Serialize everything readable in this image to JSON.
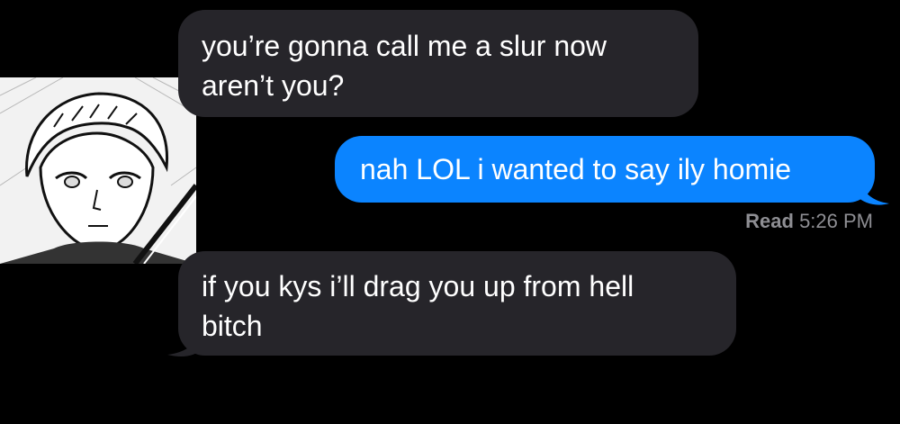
{
  "messages": [
    {
      "direction": "incoming",
      "lines": [
        "you’re gonna call me a slur now",
        "aren’t you?"
      ]
    },
    {
      "direction": "outgoing",
      "lines": [
        "nah LOL i wanted to say ily homie"
      ]
    },
    {
      "direction": "incoming",
      "lines": [
        "if you kys i’ll drag you up from hell",
        "bitch"
      ]
    }
  ],
  "read_receipt": {
    "label": "Read",
    "time": "5:26 PM"
  },
  "colors": {
    "background": "#000000",
    "incoming_bubble": "#26252a",
    "outgoing_bubble": "#0b84ff",
    "receipt_text": "#8e8e93"
  }
}
